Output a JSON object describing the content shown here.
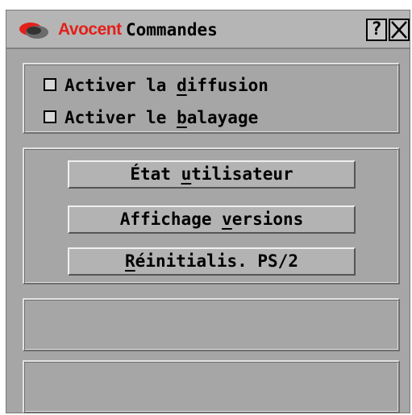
{
  "window": {
    "brand": "Avocent",
    "title": "Commandes",
    "help_label": "?",
    "close_icon": "close-icon",
    "colors": {
      "brand": "#e3201b",
      "background": "#a6a6a6"
    }
  },
  "options": [
    {
      "pre": "Activer la ",
      "key": "d",
      "post": "iffusion",
      "checked": false
    },
    {
      "pre": "Activer le ",
      "key": "b",
      "post": "alayage",
      "checked": false
    }
  ],
  "buttons": [
    {
      "pre": "État ",
      "key": "u",
      "post": "tilisateur"
    },
    {
      "pre": "Affichage ",
      "key": "v",
      "post": "ersions"
    },
    {
      "pre": "",
      "key": "R",
      "post": "éinitialis. PS/2"
    }
  ]
}
